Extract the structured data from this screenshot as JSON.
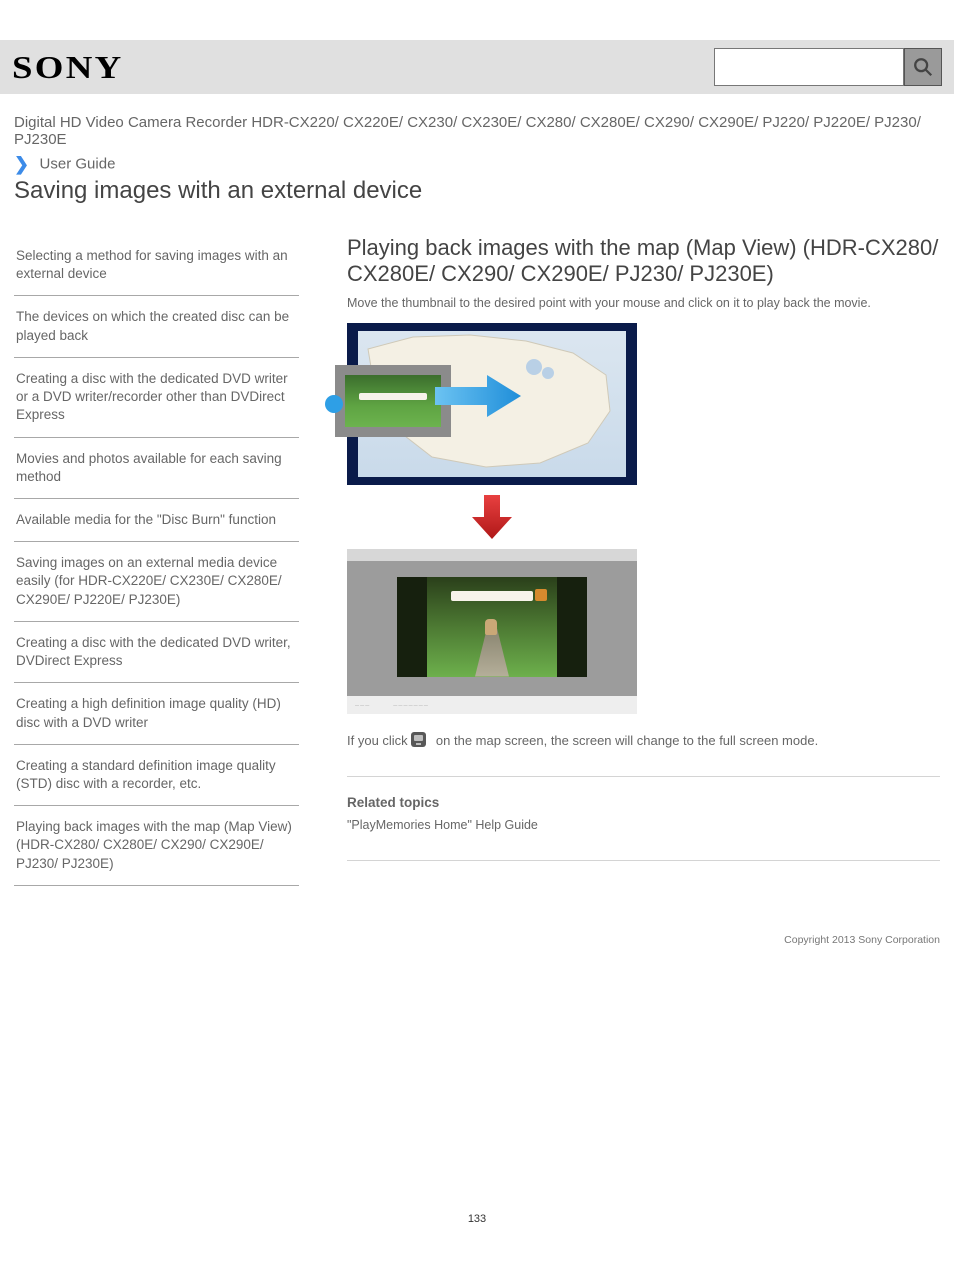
{
  "logo": "SONY",
  "product_title": "Digital HD Video Camera Recorder HDR-CX220/ CX220E/ CX230/ CX230E/ CX280/ CX280E/ CX290/ CX290E/ PJ220/ PJ220E/ PJ230/ PJ230E",
  "section_label": "User Guide",
  "heading_main": "Saving images with an external device",
  "sidebar": {
    "items": [
      "Selecting a method for saving images with an external device",
      "The devices on which the created disc can be played back",
      "Creating a disc with the dedicated DVD writer or a DVD writer/recorder other than DVDirect Express",
      "Movies and photos available for each saving method",
      "Available media for the \"Disc Burn\" function",
      "Saving images on an external media device easily (for HDR-CX220E/ CX230E/ CX280E/ CX290E/ PJ220E/ PJ230E)",
      "Creating a disc with the dedicated DVD writer, DVDirect Express",
      "Creating a high definition image quality (HD) disc with a DVD writer",
      "Creating a standard definition image quality (STD) disc with a recorder, etc.",
      "Playing back images with the map (Map View) (HDR-CX280/ CX280E/ CX290/ CX290E/ PJ230/ PJ230E)"
    ]
  },
  "main": {
    "heading": "Playing back images with the map (Map View) (HDR-CX280/ CX280E/ CX290/ CX290E/ PJ230/ PJ230E)",
    "sub": "Move the thumbnail to the desired point with your mouse and click on it to play back the movie.",
    "hint_prefix": "If you click ",
    "hint_suffix": " on the map screen, the screen will change to the full screen mode.",
    "related_heading": "Related topics",
    "related_link": "\"PlayMemories Home\" Help Guide"
  },
  "copyright": "Copyright 2013 Sony Corporation",
  "page_number": "133"
}
